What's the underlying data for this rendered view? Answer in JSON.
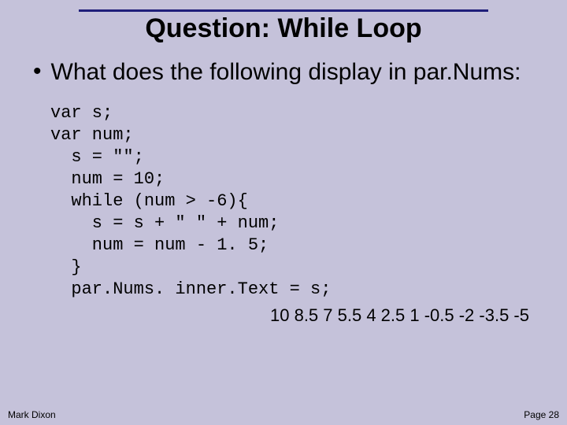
{
  "title": "Question: While Loop",
  "bullet": "What does the following display in par.Nums:",
  "code": "var s;\nvar num;\n  s = \"\";\n  num = 10;\n  while (num > -6){\n    s = s + \" \" + num;\n    num = num - 1. 5;\n  }\n  par.Nums. inner.Text = s;",
  "answer": "10 8.5 7 5.5 4 2.5 1 -0.5 -2 -3.5 -5",
  "footer": {
    "author": "Mark Dixon",
    "page": "Page 28"
  }
}
